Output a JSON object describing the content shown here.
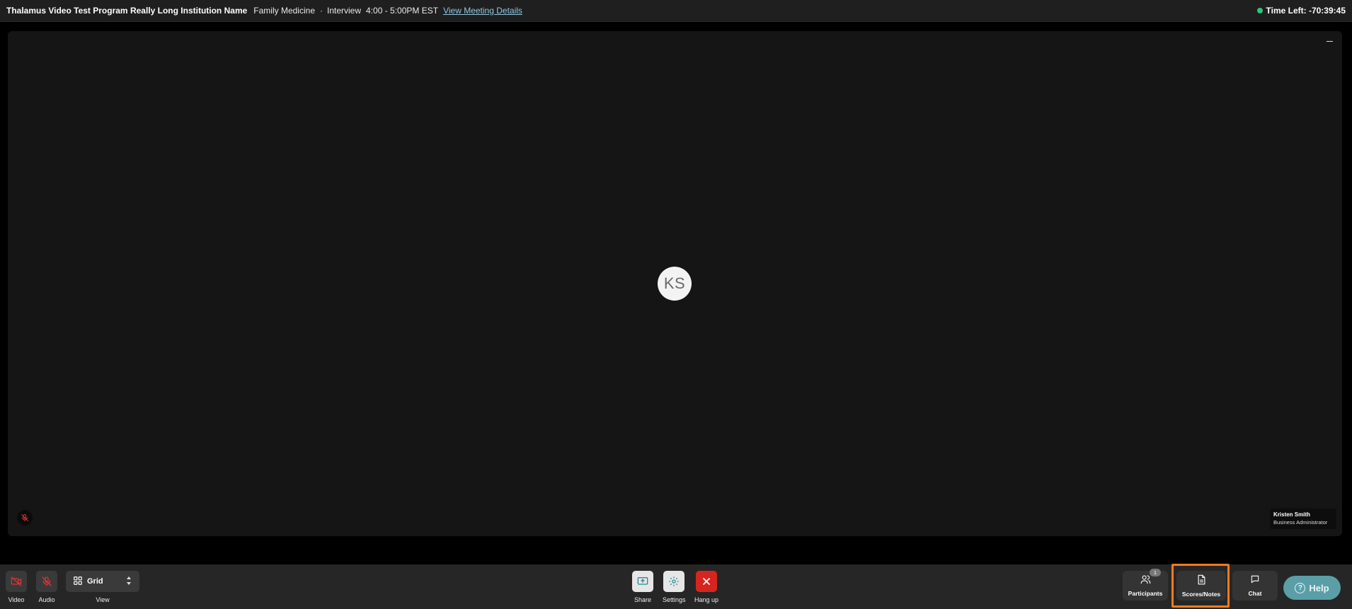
{
  "topbar": {
    "program_title": "Thalamus Video Test Program Really Long Institution Name",
    "specialty": "Family Medicine",
    "separator": "·",
    "event_type": "Interview",
    "time_range": "4:00 - 5:00PM EST",
    "details_link": "View Meeting Details",
    "time_left": "Time Left: -70:39:45",
    "status_color": "#2fc47a"
  },
  "stage": {
    "avatar_initials": "KS",
    "participant_name": "Kristen Smith",
    "participant_role": "Business Administrator"
  },
  "toolbar": {
    "video_label": "Video",
    "audio_label": "Audio",
    "view_value": "Grid",
    "view_label": "View",
    "share_label": "Share",
    "settings_label": "Settings",
    "hangup_label": "Hang up",
    "participants_label": "Participants",
    "participants_count": "1",
    "scores_label": "Scores/Notes",
    "chat_label": "Chat",
    "help_label": "Help",
    "highlight_color": "#f47b20",
    "hangup_color": "#d6251f"
  }
}
